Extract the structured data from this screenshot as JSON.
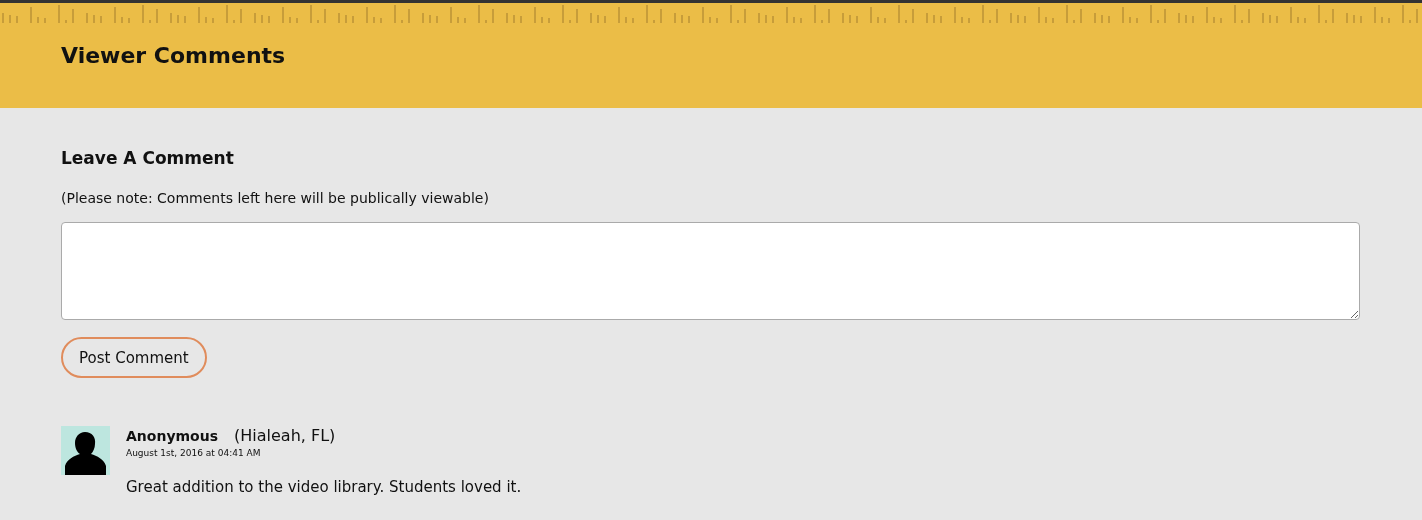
{
  "header": {
    "title": "Viewer Comments"
  },
  "form": {
    "heading": "Leave A Comment",
    "note": "(Please note: Comments left here will be publically viewable)",
    "submit": "Post Comment"
  },
  "comments": [
    {
      "author": "Anonymous",
      "location": "(Hialeah, FL)",
      "date": "August 1st, 2016 at 04:41 AM",
      "text": "Great addition to the video library. Students loved it."
    }
  ]
}
